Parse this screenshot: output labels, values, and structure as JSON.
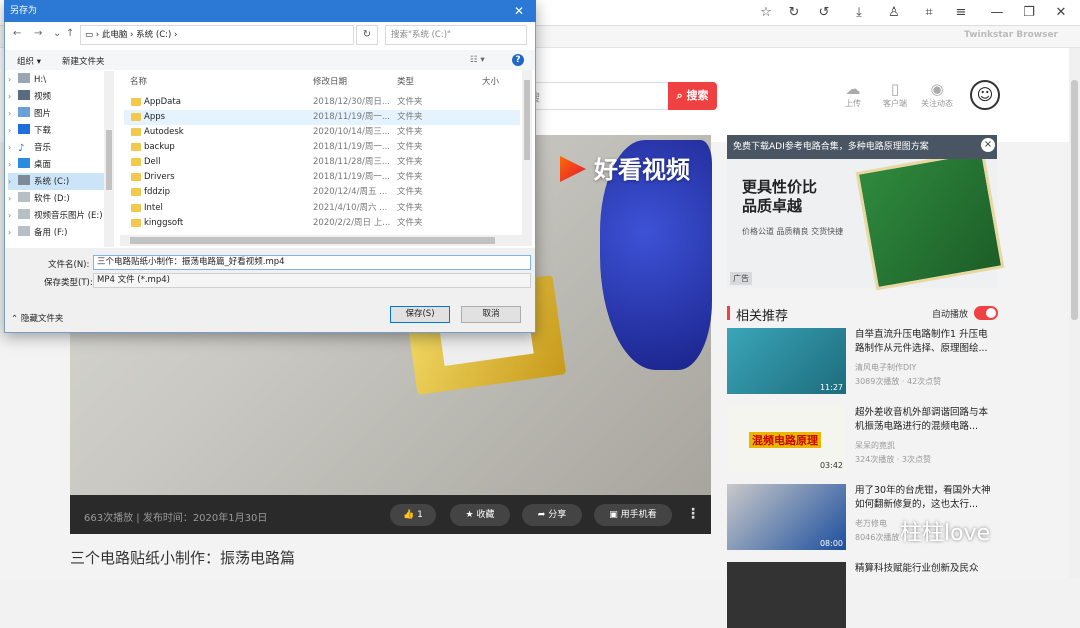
{
  "browser": {
    "brand": "Twinkstar Browser"
  },
  "header": {
    "search_placeholder": "搜",
    "search_button": "搜索",
    "upload": "上传",
    "client": "客户端",
    "follow": "关注动态"
  },
  "video": {
    "logo": "好看视频",
    "stats": "663次播放 | 发布时间：2020年1月30日",
    "like": "1",
    "collect": "收藏",
    "share": "分享",
    "phone": "用手机看",
    "title": "三个电路贴纸小制作：振荡电路篇"
  },
  "ad": {
    "banner": "免费下载ADI参考电路合集，多种电路原理图方案",
    "line1": "更具性价比",
    "line2": "品质卓越",
    "sub": "价格公道  品质精良  交货快捷",
    "tag": "广告"
  },
  "related": {
    "title": "相关推荐",
    "autoplay": "自动播放",
    "items": [
      {
        "title": "自举直流升压电路制作1 升压电路制作从元件选择、原理图绘...",
        "author": "清风电子制作DIY",
        "meta": "3089次播放 · 42次点赞",
        "duration": "11:27"
      },
      {
        "title": "超外差收音机外部调谐回路与本机振荡电路进行的混频电路...",
        "author": "呆呆的竟凯",
        "meta": "324次播放 · 3次点赞",
        "duration": "03:42",
        "overlay": "混频电路原理"
      },
      {
        "title": "用了30年的台虎钳，看国外大神如何翻新修复的，这也太行...",
        "author": "老万修电",
        "meta": "8046次播放",
        "duration": "08:00"
      },
      {
        "title": "精算科技赋能行业创新及民众",
        "author": "",
        "meta": "",
        "duration": ""
      }
    ]
  },
  "watermark": "柱柱love",
  "dialog": {
    "title": "另存为",
    "address": [
      "此电脑",
      "系统 (C:)"
    ],
    "search_placeholder": "搜索\"系统 (C:)\"",
    "toolbar": {
      "organize": "组织 ▾",
      "new_folder": "新建文件夹"
    },
    "tree": [
      "H:\\",
      "视频",
      "图片",
      "下载",
      "音乐",
      "桌面",
      "系统 (C:)",
      "软件 (D:)",
      "视频音乐图片 (E:)",
      "备用 (F:)"
    ],
    "columns": {
      "name": "名称",
      "date": "修改日期",
      "type": "类型",
      "size": "大小"
    },
    "files": [
      {
        "name": "AppData",
        "date": "2018/12/30/周日...",
        "type": "文件夹"
      },
      {
        "name": "Apps",
        "date": "2018/11/19/周一...",
        "type": "文件夹"
      },
      {
        "name": "Autodesk",
        "date": "2020/10/14/周三...",
        "type": "文件夹"
      },
      {
        "name": "backup",
        "date": "2018/11/19/周一...",
        "type": "文件夹"
      },
      {
        "name": "Dell",
        "date": "2018/11/28/周三...",
        "type": "文件夹"
      },
      {
        "name": "Drivers",
        "date": "2018/11/19/周一...",
        "type": "文件夹"
      },
      {
        "name": "fddzip",
        "date": "2020/12/4/周五 ...",
        "type": "文件夹"
      },
      {
        "name": "Intel",
        "date": "2021/4/10/周六 ...",
        "type": "文件夹"
      },
      {
        "name": "kinggsoft",
        "date": "2020/2/2/周日 上...",
        "type": "文件夹"
      }
    ],
    "filename_label": "文件名(N):",
    "filename": "三个电路贴纸小制作：振荡电路篇_好看视频.mp4",
    "filetype_label": "保存类型(T):",
    "filetype": "MP4 文件 (*.mp4)",
    "hide_folders": "隐藏文件夹",
    "save": "保存(S)",
    "cancel": "取消"
  }
}
